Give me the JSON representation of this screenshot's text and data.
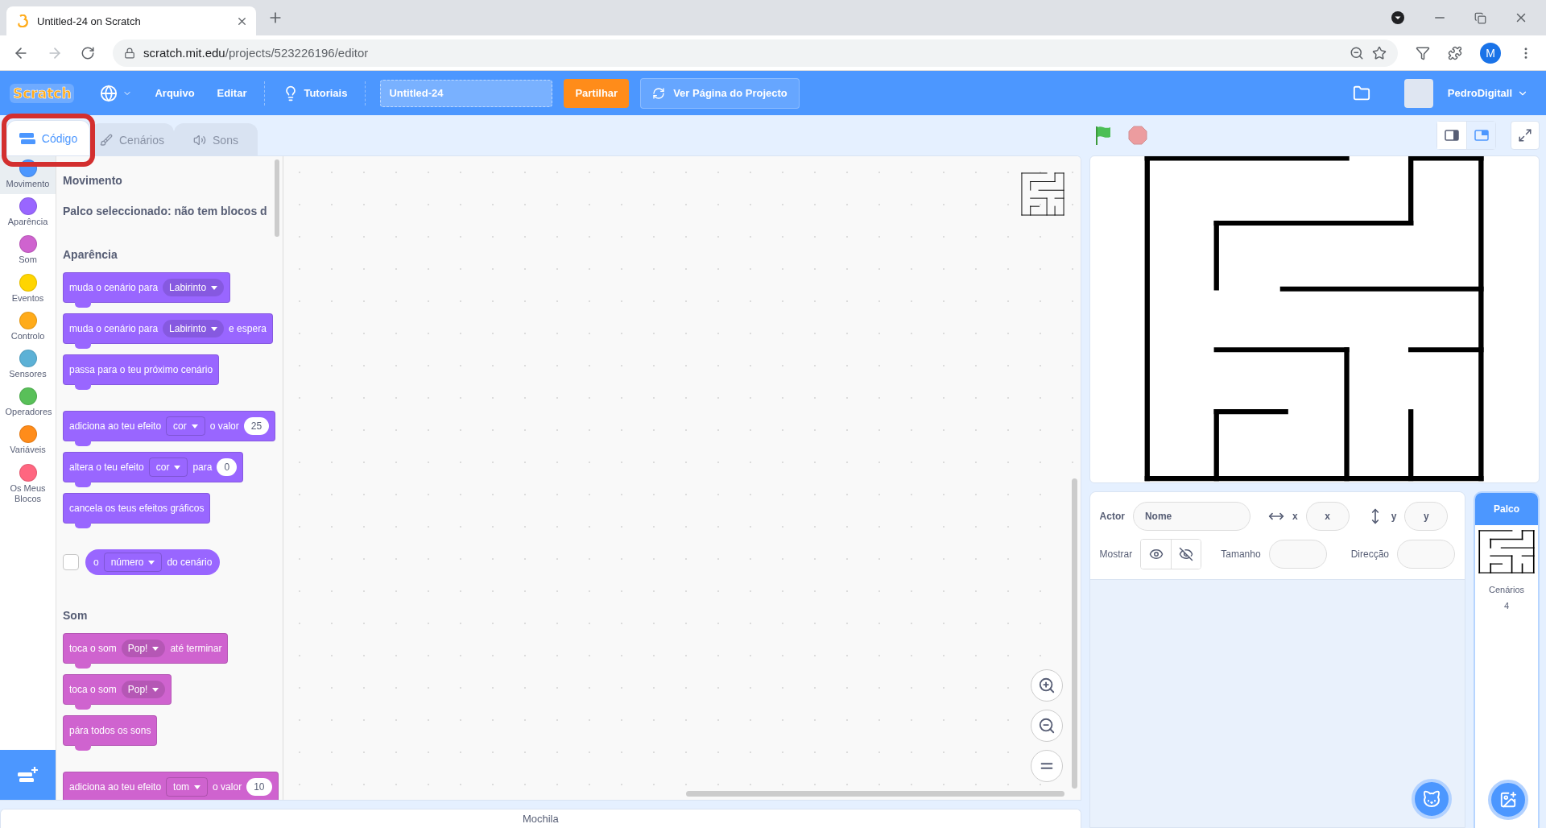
{
  "browser": {
    "tab_title": "Untitled-24 on Scratch",
    "url_host": "scratch.mit.edu",
    "url_path": "/projects/523226196/editor",
    "profile_initial": "M"
  },
  "menu_bar": {
    "logo": "Scratch",
    "items": [
      "Arquivo",
      "Editar"
    ],
    "tutorials": "Tutoriais",
    "project_title": "Untitled-24",
    "share": "Partilhar",
    "project_page": "Ver Página do Projecto",
    "username": "PedroDigitall"
  },
  "editor_tabs": [
    {
      "label": "Código",
      "kind": "code",
      "selected": true
    },
    {
      "label": "Cenários",
      "kind": "costumes",
      "selected": false
    },
    {
      "label": "Sons",
      "kind": "sounds",
      "selected": false
    }
  ],
  "categories": [
    {
      "label": "Movimento",
      "color": "#4c97ff",
      "selected": true
    },
    {
      "label": "Aparência",
      "color": "#9966ff",
      "selected": false
    },
    {
      "label": "Som",
      "color": "#cf63cf",
      "selected": false
    },
    {
      "label": "Eventos",
      "color": "#ffd500",
      "selected": false
    },
    {
      "label": "Controlo",
      "color": "#ffab19",
      "selected": false
    },
    {
      "label": "Sensores",
      "color": "#5cb1d6",
      "selected": false
    },
    {
      "label": "Operadores",
      "color": "#59c059",
      "selected": false
    },
    {
      "label": "Variáveis",
      "color": "#ff8c1a",
      "selected": false
    },
    {
      "label": "Os Meus Blocos",
      "color": "#ff6680",
      "selected": false
    }
  ],
  "palette": [
    {
      "title": "Movimento",
      "note": "Palco seleccionado: não tem blocos d"
    },
    {
      "title": "Aparência",
      "color": "#9966ff",
      "groups": [
        [
          {
            "kind": "stack",
            "parts": [
              {
                "kind": "text",
                "text": "muda o cenário para"
              },
              {
                "kind": "dropdown",
                "text": "Labirinto"
              }
            ]
          },
          {
            "kind": "stack",
            "parts": [
              {
                "kind": "text",
                "text": "muda o cenário para"
              },
              {
                "kind": "dropdown",
                "text": "Labirinto"
              },
              {
                "kind": "text",
                "text": "e espera"
              }
            ]
          },
          {
            "kind": "stack",
            "parts": [
              {
                "kind": "text",
                "text": "passa para o teu próximo cenário"
              }
            ]
          }
        ],
        [
          {
            "kind": "stack",
            "parts": [
              {
                "kind": "text",
                "text": "adiciona ao teu efeito"
              },
              {
                "kind": "menu",
                "text": "cor"
              },
              {
                "kind": "text",
                "text": "o valor"
              },
              {
                "kind": "number",
                "text": "25"
              }
            ]
          },
          {
            "kind": "stack",
            "parts": [
              {
                "kind": "text",
                "text": "altera o teu efeito"
              },
              {
                "kind": "menu",
                "text": "cor"
              },
              {
                "kind": "text",
                "text": "para"
              },
              {
                "kind": "number",
                "text": "0"
              }
            ]
          },
          {
            "kind": "stack",
            "parts": [
              {
                "kind": "text",
                "text": "cancela os teus efeitos gráficos"
              }
            ]
          }
        ],
        [
          {
            "kind": "reporter",
            "checked": false,
            "parts": [
              {
                "kind": "text",
                "text": "o"
              },
              {
                "kind": "menu",
                "text": "número"
              },
              {
                "kind": "text",
                "text": "do cenário"
              }
            ]
          }
        ]
      ]
    },
    {
      "title": "Som",
      "color": "#cf63cf",
      "groups": [
        [
          {
            "kind": "stack",
            "parts": [
              {
                "kind": "text",
                "text": "toca o som"
              },
              {
                "kind": "dropdown",
                "text": "Pop!"
              },
              {
                "kind": "text",
                "text": "até terminar"
              }
            ]
          },
          {
            "kind": "stack",
            "parts": [
              {
                "kind": "text",
                "text": "toca o som"
              },
              {
                "kind": "dropdown",
                "text": "Pop!"
              }
            ]
          },
          {
            "kind": "stack",
            "parts": [
              {
                "kind": "text",
                "text": "pára todos os sons"
              }
            ]
          }
        ],
        [
          {
            "kind": "stack",
            "parts": [
              {
                "kind": "text",
                "text": "adiciona ao teu efeito"
              },
              {
                "kind": "menu",
                "text": "tom"
              },
              {
                "kind": "text",
                "text": "o valor"
              },
              {
                "kind": "number",
                "text": "10"
              }
            ]
          }
        ]
      ]
    }
  ],
  "stage_layout": [
    {
      "kind": "small",
      "selected": false
    },
    {
      "kind": "normal",
      "selected": true
    }
  ],
  "sprite_info": {
    "actor_label": "Actor",
    "name_placeholder": "Nome",
    "x_label": "x",
    "x_placeholder": "x",
    "y_label": "y",
    "y_placeholder": "y",
    "show_label": "Mostrar",
    "size_label": "Tamanho",
    "direction_label": "Direcção"
  },
  "stage_panel": {
    "title": "Palco",
    "backdrops_label": "Cenários",
    "backdrops_count": "4"
  },
  "backpack": "Mochila"
}
